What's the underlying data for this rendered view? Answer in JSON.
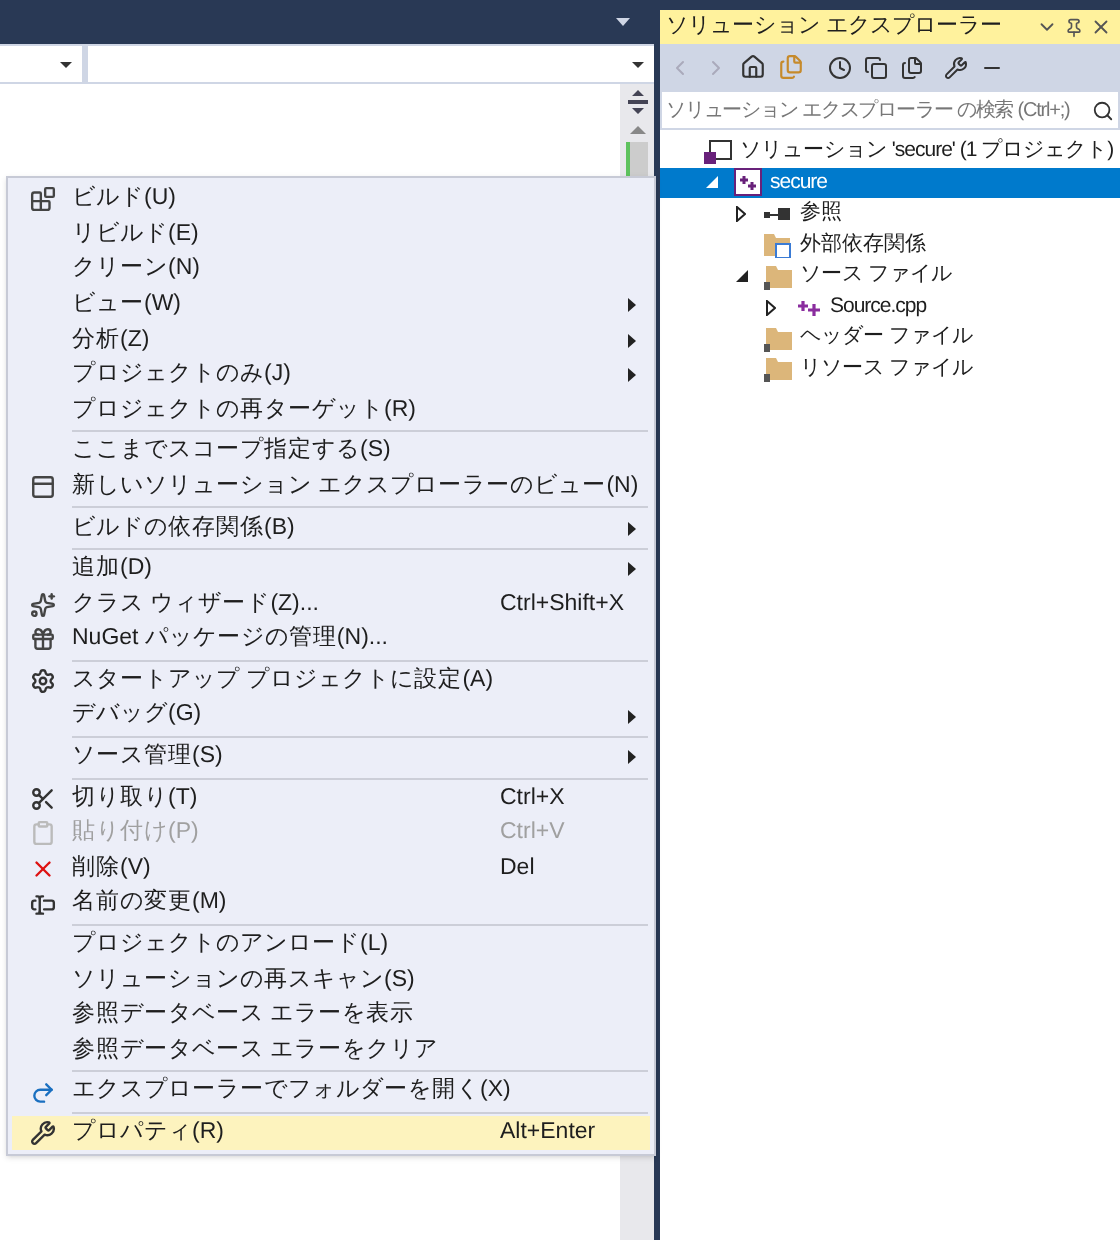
{
  "solution_explorer": {
    "title": "ソリューション エクスプローラー",
    "search": {
      "placeholder": "ソリューション エクスプローラー の検索 (Ctrl+;)"
    },
    "tree": [
      {
        "kind": "solution",
        "label": "ソリューション 'secure' (1 プロジェクト)",
        "selected": false,
        "children": [
          {
            "kind": "project",
            "label": "secure",
            "selected": true,
            "expanded": true,
            "children": [
              {
                "kind": "references",
                "label": "参照",
                "selected": false,
                "expanded": false
              },
              {
                "kind": "external",
                "label": "外部依存関係",
                "selected": false
              },
              {
                "kind": "folder",
                "label": "ソース ファイル",
                "selected": false,
                "expanded": true,
                "children": [
                  {
                    "kind": "cpp",
                    "label": "Source.cpp",
                    "selected": false,
                    "expanded": false
                  }
                ]
              },
              {
                "kind": "folder",
                "label": "ヘッダー ファイル",
                "selected": false
              },
              {
                "kind": "folder",
                "label": "リソース ファイル",
                "selected": false
              }
            ]
          }
        ]
      }
    ]
  },
  "context_menu": {
    "groups": [
      [
        {
          "label": "ビルド(U)",
          "selected": false,
          "disabled": false,
          "submenu": false
        },
        {
          "label": "リビルド(E)",
          "selected": false,
          "disabled": false,
          "submenu": false
        },
        {
          "label": "クリーン(N)",
          "selected": false,
          "disabled": false,
          "submenu": false
        },
        {
          "label": "ビュー(W)",
          "selected": false,
          "disabled": false,
          "submenu": true
        },
        {
          "label": "分析(Z)",
          "selected": false,
          "disabled": false,
          "submenu": true
        },
        {
          "label": "プロジェクトのみ(J)",
          "selected": false,
          "disabled": false,
          "submenu": true
        },
        {
          "label": "プロジェクトの再ターゲット(R)",
          "selected": false,
          "disabled": false,
          "submenu": false
        }
      ],
      [
        {
          "label": "ここまでスコープ指定する(S)",
          "selected": false,
          "disabled": false,
          "submenu": false
        },
        {
          "label": "新しいソリューション エクスプローラーのビュー(N)",
          "selected": false,
          "disabled": false,
          "submenu": false
        }
      ],
      [
        {
          "label": "ビルドの依存関係(B)",
          "selected": false,
          "disabled": false,
          "submenu": true
        }
      ],
      [
        {
          "label": "追加(D)",
          "selected": false,
          "disabled": false,
          "submenu": true
        },
        {
          "label": "クラス ウィザード(Z)...",
          "shortcut": "Ctrl+Shift+X",
          "selected": false,
          "disabled": false,
          "submenu": false
        },
        {
          "label": "NuGet パッケージの管理(N)...",
          "selected": false,
          "disabled": false,
          "submenu": false
        }
      ],
      [
        {
          "label": "スタートアップ プロジェクトに設定(A)",
          "selected": false,
          "disabled": false,
          "submenu": false
        },
        {
          "label": "デバッグ(G)",
          "selected": false,
          "disabled": false,
          "submenu": true
        }
      ],
      [
        {
          "label": "ソース管理(S)",
          "selected": false,
          "disabled": false,
          "submenu": true
        }
      ],
      [
        {
          "label": "切り取り(T)",
          "shortcut": "Ctrl+X",
          "selected": false,
          "disabled": false,
          "submenu": false
        },
        {
          "label": "貼り付け(P)",
          "shortcut": "Ctrl+V",
          "selected": false,
          "disabled": true,
          "submenu": false
        },
        {
          "label": "削除(V)",
          "shortcut": "Del",
          "selected": false,
          "disabled": false,
          "submenu": false
        },
        {
          "label": "名前の変更(M)",
          "selected": false,
          "disabled": false,
          "submenu": false
        }
      ],
      [
        {
          "label": "プロジェクトのアンロード(L)",
          "selected": false,
          "disabled": false,
          "submenu": false
        },
        {
          "label": "ソリューションの再スキャン(S)",
          "selected": false,
          "disabled": false,
          "submenu": false
        },
        {
          "label": "参照データベース エラーを表示",
          "selected": false,
          "disabled": false,
          "submenu": false
        },
        {
          "label": "参照データベース エラーをクリア",
          "selected": false,
          "disabled": false,
          "submenu": false
        }
      ],
      [
        {
          "label": "エクスプローラーでフォルダーを開く(X)",
          "selected": false,
          "disabled": false,
          "submenu": false
        }
      ],
      [
        {
          "label": "プロパティ(R)",
          "shortcut": "Alt+Enter",
          "selected": true,
          "disabled": false,
          "submenu": false
        }
      ]
    ]
  }
}
